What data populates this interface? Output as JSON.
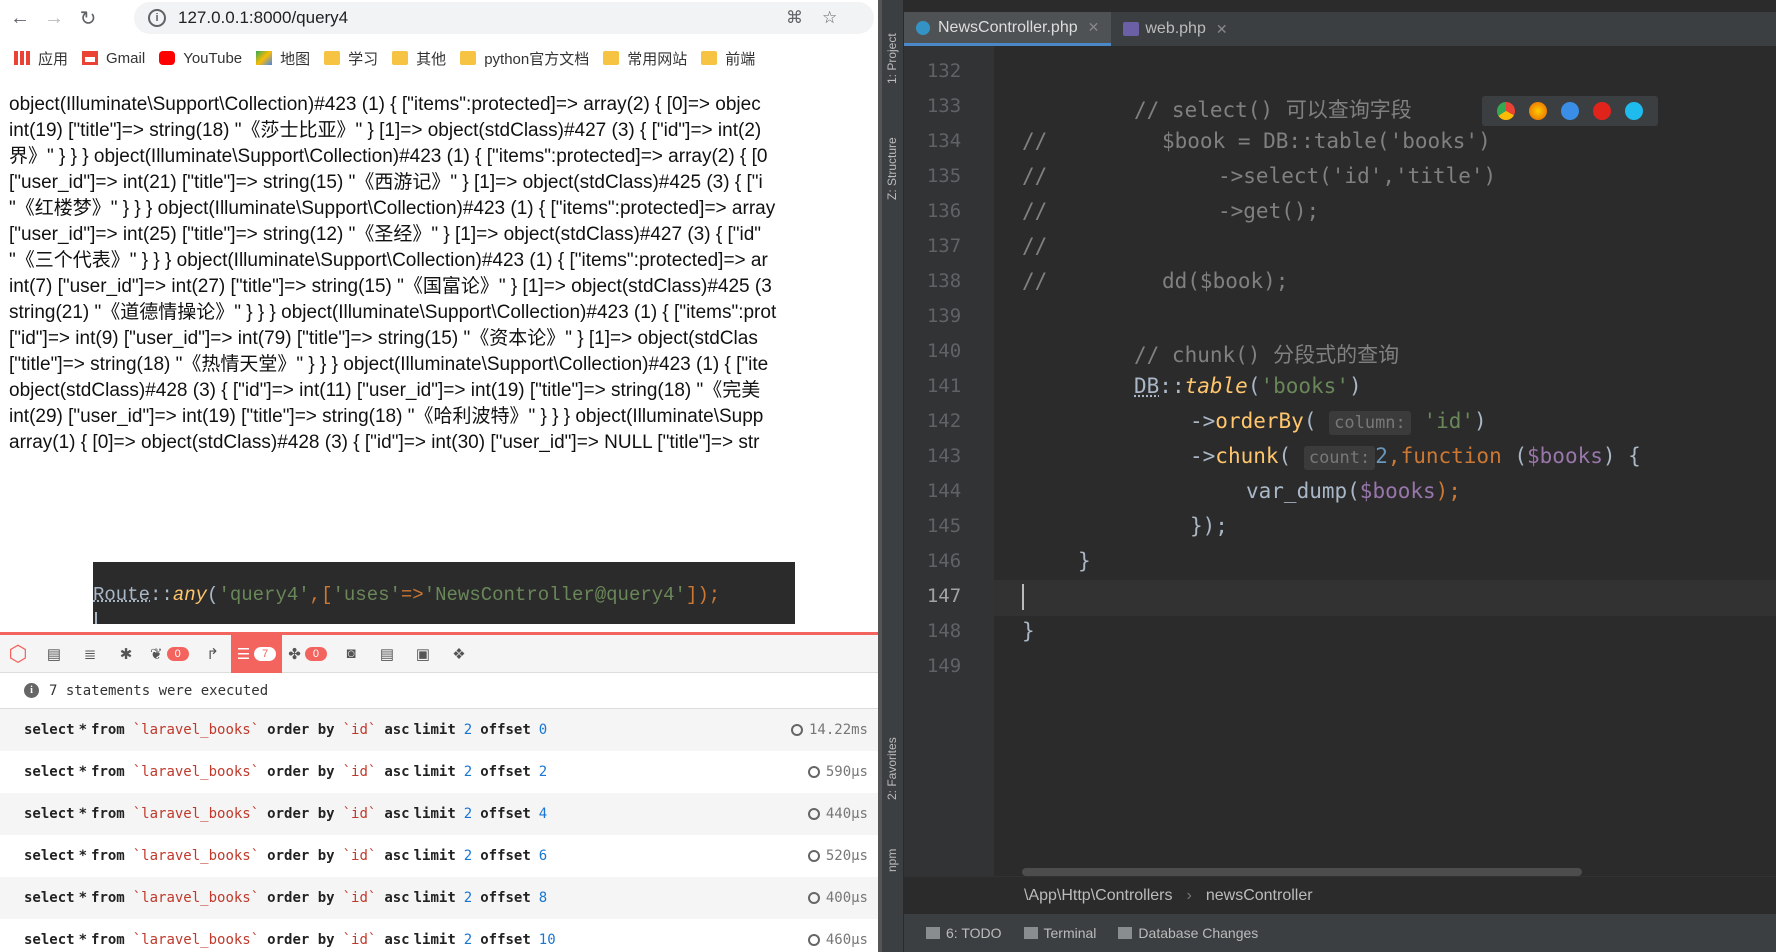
{
  "browser": {
    "url": "127.0.0.1:8000/query4"
  },
  "bookmarks": [
    {
      "label": "应用",
      "icon": "apps-grid-icon"
    },
    {
      "label": "Gmail",
      "icon": "gmail-icon"
    },
    {
      "label": "YouTube",
      "icon": "youtube-icon"
    },
    {
      "label": "地图",
      "icon": "maps-icon"
    },
    {
      "label": "学习",
      "icon": "folder-icon"
    },
    {
      "label": "其他",
      "icon": "folder-icon"
    },
    {
      "label": "python官方文档",
      "icon": "folder-icon"
    },
    {
      "label": "常用网站",
      "icon": "folder-icon"
    },
    {
      "label": "前端",
      "icon": "folder-icon"
    }
  ],
  "dump_lines": [
    "object(Illuminate\\Support\\Collection)#423 (1) { [\"items\":protected]=> array(2) { [0]=> objec",
    "int(19) [\"title\"]=> string(18) \"《莎士比亚》\" } [1]=> object(stdClass)#427 (3) { [\"id\"]=> int(2)",
    "界》\" } } } object(Illuminate\\Support\\Collection)#423 (1) { [\"items\":protected]=> array(2) { [0",
    "[\"user_id\"]=> int(21) [\"title\"]=> string(15) \"《西游记》\" } [1]=> object(stdClass)#425 (3) { [\"i",
    "\"《红楼梦》\" } } } object(Illuminate\\Support\\Collection)#423 (1) { [\"items\":protected]=> array",
    "[\"user_id\"]=> int(25) [\"title\"]=> string(12) \"《圣经》\" } [1]=> object(stdClass)#427 (3) { [\"id\"",
    "\"《三个代表》\" } } } object(Illuminate\\Support\\Collection)#423 (1) { [\"items\":protected]=> ar",
    "int(7) [\"user_id\"]=> int(27) [\"title\"]=> string(15) \"《国富论》\" } [1]=> object(stdClass)#425 (3",
    "string(21) \"《道德情操论》\" } } } object(Illuminate\\Support\\Collection)#423 (1) { [\"items\":prot",
    "[\"id\"]=> int(9) [\"user_id\"]=> int(79) [\"title\"]=> string(15) \"《资本论》\" } [1]=> object(stdClas",
    "[\"title\"]=> string(18) \"《热情天堂》\" } } } object(Illuminate\\Support\\Collection)#423 (1) { [\"ite",
    "object(stdClass)#428 (3) { [\"id\"]=> int(11) [\"user_id\"]=> int(19) [\"title\"]=> string(18) \"《完美",
    "int(29) [\"user_id\"]=> int(19) [\"title\"]=> string(18) \"《哈利波特》\" } } } object(Illuminate\\Supp",
    "array(1) { [0]=> object(stdClass)#428 (3) { [\"id\"]=> int(30) [\"user_id\"]=> NULL [\"title\"]=> str"
  ],
  "route_popup": {
    "p1": "Route",
    "p2": "::",
    "p3": "any",
    "p4": "(",
    "p5": "'query4'",
    "p6": ",[",
    "p7": "'uses'",
    "p8": "=>",
    "p9": "'NewsController@query4'",
    "p10": "]);"
  },
  "debugbar": {
    "badges": {
      "messages": "0",
      "queries": "7",
      "models": "0"
    },
    "summary": "7 statements were executed",
    "statements": [
      {
        "select": "select",
        "star": "*",
        "from": "from",
        "table": "`laravel_books`",
        "order": "order by",
        "col": "`id`",
        "dir": "asc",
        "limit": "limit",
        "lv": "2",
        "offset": "offset",
        "ov": "0",
        "time": "14.22ms"
      },
      {
        "select": "select",
        "star": "*",
        "from": "from",
        "table": "`laravel_books`",
        "order": "order by",
        "col": "`id`",
        "dir": "asc",
        "limit": "limit",
        "lv": "2",
        "offset": "offset",
        "ov": "2",
        "time": "590μs"
      },
      {
        "select": "select",
        "star": "*",
        "from": "from",
        "table": "`laravel_books`",
        "order": "order by",
        "col": "`id`",
        "dir": "asc",
        "limit": "limit",
        "lv": "2",
        "offset": "offset",
        "ov": "4",
        "time": "440μs"
      },
      {
        "select": "select",
        "star": "*",
        "from": "from",
        "table": "`laravel_books`",
        "order": "order by",
        "col": "`id`",
        "dir": "asc",
        "limit": "limit",
        "lv": "2",
        "offset": "offset",
        "ov": "6",
        "time": "520μs"
      },
      {
        "select": "select",
        "star": "*",
        "from": "from",
        "table": "`laravel_books`",
        "order": "order by",
        "col": "`id`",
        "dir": "asc",
        "limit": "limit",
        "lv": "2",
        "offset": "offset",
        "ov": "8",
        "time": "400μs"
      },
      {
        "select": "select",
        "star": "*",
        "from": "from",
        "table": "`laravel_books`",
        "order": "order by",
        "col": "`id`",
        "dir": "asc",
        "limit": "limit",
        "lv": "2",
        "offset": "offset",
        "ov": "10",
        "time": "460μs"
      }
    ]
  },
  "ide": {
    "side_labels": {
      "project": "1: Project",
      "structure": "Z: Structure",
      "favorites": "2: Favorites",
      "npm": "npm"
    },
    "tabs": [
      {
        "label": "NewsController.php"
      },
      {
        "label": "web.php"
      }
    ],
    "line_numbers": [
      "132",
      "133",
      "134",
      "135",
      "136",
      "137",
      "138",
      "139",
      "140",
      "141",
      "142",
      "143",
      "144",
      "145",
      "146",
      "147",
      "148",
      "149"
    ],
    "code": {
      "l133": "// select() 可以查询字段",
      "l134a": "//",
      "l134b": "$book = DB::table('books')",
      "l135a": "//",
      "l135b": "->select('id','title')",
      "l136a": "//",
      "l136b": "->get();",
      "l137a": "//",
      "l138a": "//",
      "l138b": "dd($book);",
      "l140": "// chunk() 分段式的查询",
      "l141a": "DB",
      "l141b": "::",
      "l141c": "table",
      "l141d": "(",
      "l141e": "'books'",
      "l141f": ")",
      "l142a": "->",
      "l142b": "orderBy",
      "l142c": "(",
      "l142h": "column:",
      "l142d": "'id'",
      "l142e": ")",
      "l143a": "->",
      "l143b": "chunk",
      "l143c": "(",
      "l143h": "count:",
      "l143d": "2",
      "l143e": ",",
      "l143f": "function",
      "l143g": " (",
      "l143i": "$books",
      "l143j": ") {",
      "l144a": "var_dump(",
      "l144b": "$books",
      "l144c": ");",
      "l145": "});",
      "l146": "}",
      "l148": "}"
    },
    "breadcrumb": [
      "\\App\\Http\\Controllers",
      "newsController"
    ],
    "bottom_tabs": [
      "6: TODO",
      "Terminal",
      "Database Changes"
    ]
  }
}
